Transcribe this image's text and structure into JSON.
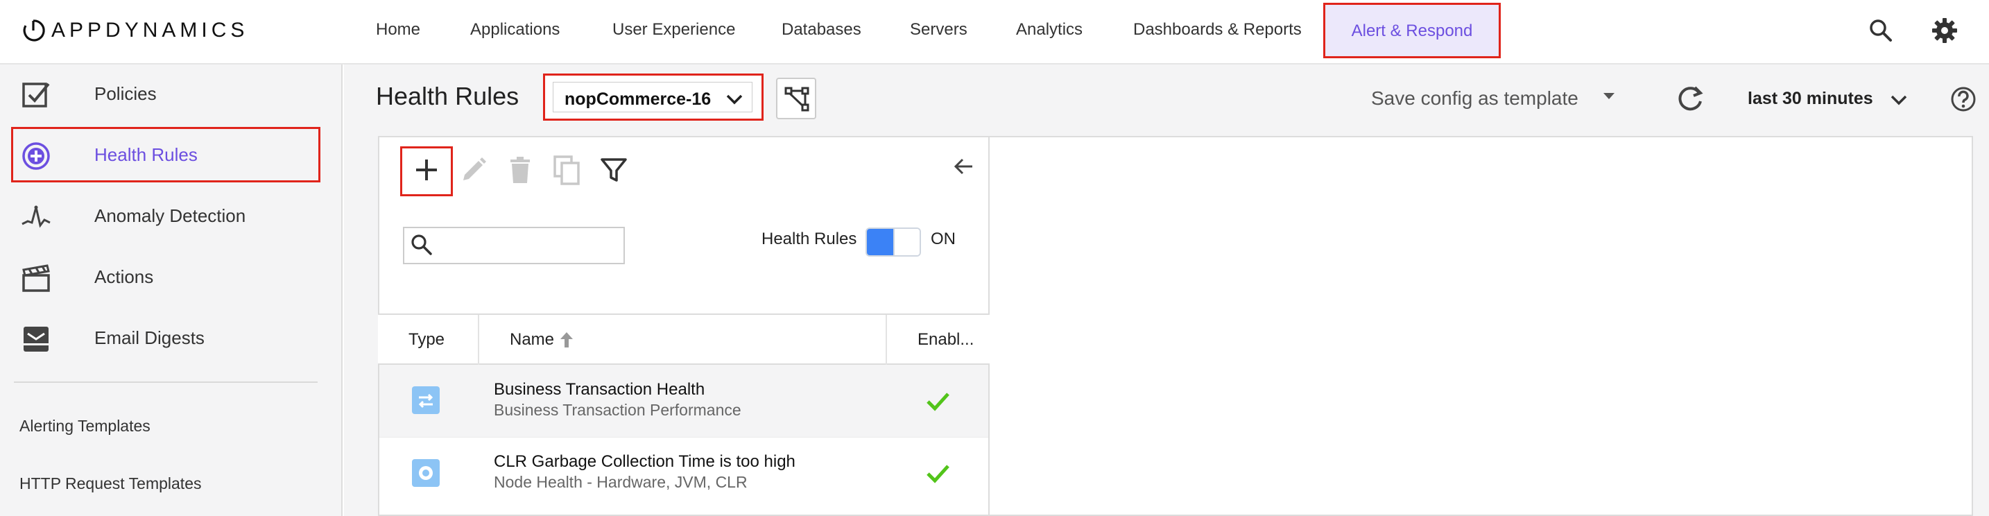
{
  "brand": {
    "logo_text": "APPDYNAMICS"
  },
  "nav": {
    "items": [
      {
        "label": "Home"
      },
      {
        "label": "Applications"
      },
      {
        "label": "User Experience"
      },
      {
        "label": "Databases"
      },
      {
        "label": "Servers"
      },
      {
        "label": "Analytics"
      },
      {
        "label": "Dashboards & Reports"
      }
    ],
    "active": {
      "label": "Alert & Respond"
    }
  },
  "sidebar": {
    "items": [
      {
        "label": "Policies",
        "icon": "checkbox-icon"
      },
      {
        "label": "Health Rules",
        "icon": "plus-circle-icon",
        "active": true
      },
      {
        "label": "Anomaly Detection",
        "icon": "anomaly-wave-icon"
      },
      {
        "label": "Actions",
        "icon": "clapperboard-icon"
      },
      {
        "label": "Email Digests",
        "icon": "mail-tray-icon"
      }
    ],
    "links": [
      {
        "label": "Alerting Templates"
      },
      {
        "label": "HTTP Request Templates"
      }
    ]
  },
  "header": {
    "title": "Health Rules",
    "app_selector": "nopCommerce-16",
    "save_config": "Save config as template",
    "time_range": "last 30 minutes"
  },
  "toolbar": {
    "toggle_label": "Health Rules",
    "toggle_state": "ON",
    "search_placeholder": ""
  },
  "table": {
    "columns": [
      "Type",
      "Name",
      "Enabl..."
    ],
    "sort": "Name ascending",
    "rows": [
      {
        "name": "Business Transaction Health",
        "sub": "Business Transaction Performance",
        "type_icon": "business-transaction-icon",
        "enabled": true
      },
      {
        "name": "CLR Garbage Collection Time is too high",
        "sub": "Node Health - Hardware, JVM, CLR",
        "type_icon": "node-health-icon",
        "enabled": true
      }
    ]
  },
  "colors": {
    "accent": "#6c4fe0",
    "highlight_box": "#e0241b",
    "toggle_on": "#3b82f6",
    "check": "#52c41a",
    "type_icon": "#8cc4f5"
  }
}
